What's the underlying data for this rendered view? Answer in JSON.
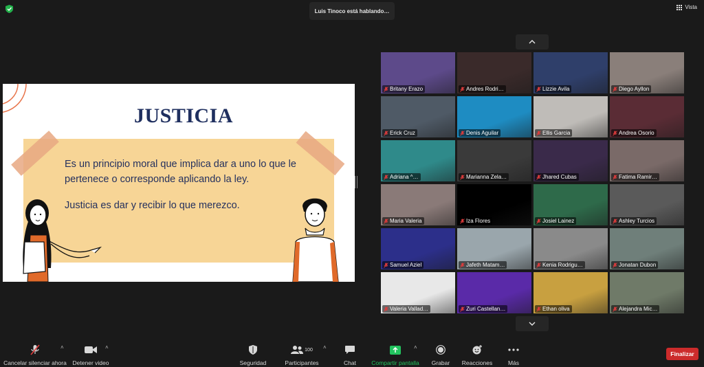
{
  "top": {
    "speaking_text": "Luis Tinoco está hablando…",
    "view_label": "Vista"
  },
  "slide": {
    "title": "JUSTICIA",
    "paragraph1": "Es un principio moral que implica dar a uno lo que le pertenece o corresponde aplicando la ley.",
    "paragraph2": "Justicia es dar y recibir lo que merezco."
  },
  "gallery": {
    "page_up_icon": "chevron-up-icon",
    "page_down_icon": "chevron-down-icon",
    "participants": [
      {
        "name": "Britany Erazo",
        "bg": "#5d4a8a"
      },
      {
        "name": "Andres Rodri…",
        "bg": "#3a2a2a"
      },
      {
        "name": "Lizzie Avila",
        "bg": "#2f3f6a"
      },
      {
        "name": "Diego Ayllon",
        "bg": "#8a7f7a"
      },
      {
        "name": "Erick Cruz",
        "bg": "#4f5a66"
      },
      {
        "name": "Denis Aguilar",
        "bg": "#1e8cc2"
      },
      {
        "name": "Ellis Garcia",
        "bg": "#bfbcb8"
      },
      {
        "name": "Andrea Osorio",
        "bg": "#5a2c35"
      },
      {
        "name": "Adriana ^…",
        "bg": "#2f8a8a"
      },
      {
        "name": "Marianna Zela…",
        "bg": "#3a3a3a"
      },
      {
        "name": "Jhared Cubas",
        "bg": "#3a2a4a"
      },
      {
        "name": "Fatima Ramir…",
        "bg": "#7a6a68"
      },
      {
        "name": "Maria Valeria",
        "bg": "#8a7a78"
      },
      {
        "name": "Iza Flores",
        "bg": "#000000"
      },
      {
        "name": "Josiel Lainez",
        "bg": "#2e6a4a"
      },
      {
        "name": "Ashley Turcios",
        "bg": "#5a5a5a"
      },
      {
        "name": "Samuel Aziel",
        "bg": "#2c2f8a"
      },
      {
        "name": "Jafeth Matam…",
        "bg": "#9aa6ac"
      },
      {
        "name": "Kenia Rodrigu…",
        "bg": "#8a8a8a"
      },
      {
        "name": "Jonatan Dubon",
        "bg": "#6f7f7a"
      },
      {
        "name": "Valeria Vallad…",
        "bg": "#e8e8e8"
      },
      {
        "name": "Zuri Castellan…",
        "bg": "#5a2aa8"
      },
      {
        "name": "Ethan oliva",
        "bg": "#c8a040"
      },
      {
        "name": "Alejandra Mic…",
        "bg": "#6f7a68"
      }
    ]
  },
  "toolbar": {
    "mute_label": "Cancelar silenciar ahora",
    "video_label": "Detener video",
    "security_label": "Seguridad",
    "participants_label": "Participantes",
    "participants_count": "100",
    "chat_label": "Chat",
    "share_label": "Compartir pantalla",
    "record_label": "Grabar",
    "reactions_label": "Reacciones",
    "more_label": "Más",
    "end_label": "Finalizar"
  },
  "colors": {
    "share_green": "#22c35e",
    "end_red": "#cc2b2b",
    "slide_navy": "#1f2f5f",
    "note_yellow": "#f7d596"
  }
}
